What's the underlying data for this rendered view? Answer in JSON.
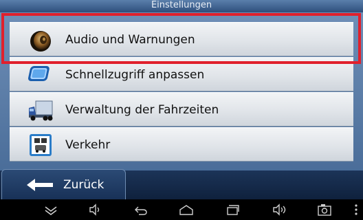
{
  "header": {
    "title": "Einstellungen"
  },
  "menu": {
    "items": [
      {
        "label": "Audio und Warnungen",
        "icon": "speaker-icon"
      },
      {
        "label": "Schnellzugriff anpassen",
        "icon": "shortcut-screen-icon"
      },
      {
        "label": "Verwaltung der Fahrzeiten",
        "icon": "truck-icon"
      },
      {
        "label": "Verkehr",
        "icon": "traffic-icon"
      }
    ]
  },
  "footer": {
    "back_label": "Zurück"
  },
  "system_nav": {
    "buttons": [
      "collapse-icon",
      "volume-down-icon",
      "back-icon",
      "home-icon",
      "recent-apps-icon",
      "volume-up-icon",
      "screenshot-icon",
      "menu-dots-icon"
    ]
  },
  "colors": {
    "highlight": "#e0202c",
    "panel": "#4a6d99",
    "item": "#e6e9ed"
  }
}
